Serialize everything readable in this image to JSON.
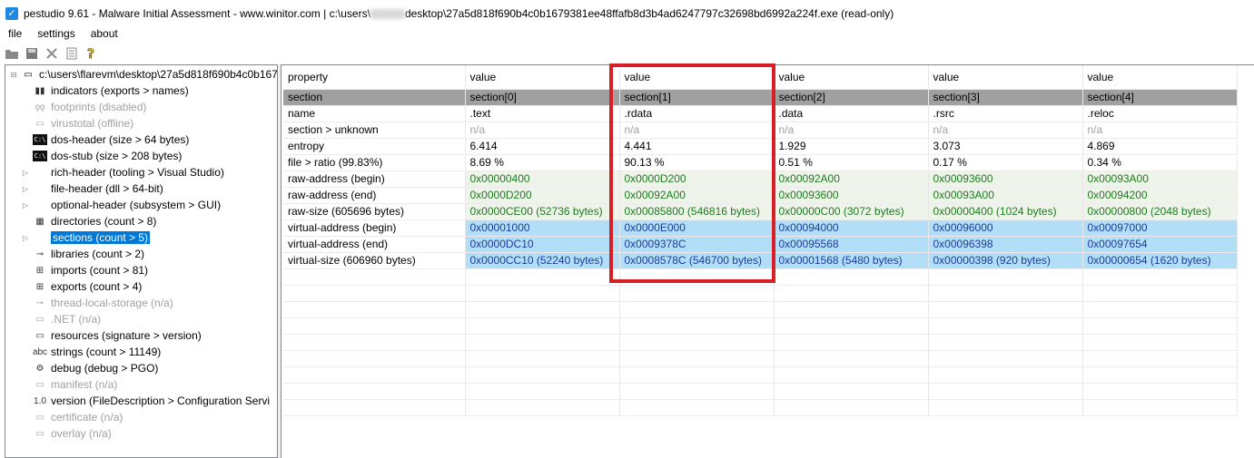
{
  "window": {
    "title_prefix": "pestudio 9.61 - Malware Initial Assessment - www.winitor.com | c:\\users\\",
    "title_suffix": "desktop\\27a5d818f690b4c0b1679381ee48ffafb8d3b4ad6247797c32698bd6992a224f.exe (read-only)",
    "icon": "checkbox-icon"
  },
  "menu": {
    "file": "file",
    "settings": "settings",
    "about": "about"
  },
  "toolbar": {
    "icons": [
      "open-icon",
      "save-icon",
      "close-icon",
      "list-icon",
      "help-icon"
    ]
  },
  "tree": {
    "root": "c:\\users\\flarevm\\desktop\\27a5d818f690b4c0b167",
    "items": [
      {
        "label": "indicators (exports > names)",
        "disabled": false
      },
      {
        "label": "footprints (disabled)",
        "disabled": true
      },
      {
        "label": "virustotal (offline)",
        "disabled": true
      },
      {
        "label": "dos-header (size > 64 bytes)",
        "disabled": false
      },
      {
        "label": "dos-stub (size > 208 bytes)",
        "disabled": false
      },
      {
        "label": "rich-header (tooling > Visual Studio)",
        "disabled": false
      },
      {
        "label": "file-header (dll > 64-bit)",
        "disabled": false
      },
      {
        "label": "optional-header (subsystem > GUI)",
        "disabled": false
      },
      {
        "label": "directories (count > 8)",
        "disabled": false
      },
      {
        "label": "sections (count > 5)",
        "disabled": false
      },
      {
        "label": "libraries (count > 2)",
        "disabled": false
      },
      {
        "label": "imports (count > 81)",
        "disabled": false
      },
      {
        "label": "exports (count > 4)",
        "disabled": false
      },
      {
        "label": "thread-local-storage (n/a)",
        "disabled": true
      },
      {
        "label": ".NET (n/a)",
        "disabled": true
      },
      {
        "label": "resources (signature > version)",
        "disabled": false
      },
      {
        "label": "strings (count > 11149)",
        "disabled": false
      },
      {
        "label": "debug (debug > PGO)",
        "disabled": false
      },
      {
        "label": "manifest (n/a)",
        "disabled": true
      },
      {
        "label": "version (FileDescription > Configuration Servi",
        "disabled": false
      },
      {
        "label": "certificate (n/a)",
        "disabled": true
      },
      {
        "label": "overlay (n/a)",
        "disabled": true
      }
    ],
    "selected": "sections (count > 5)"
  },
  "grid": {
    "headers": [
      "property",
      "value",
      "value",
      "value",
      "value",
      "value"
    ],
    "rows": [
      [
        "section",
        "section[0]",
        "section[1]",
        "section[2]",
        "section[3]",
        "section[4]"
      ],
      [
        "name",
        ".text",
        ".rdata",
        ".data",
        ".rsrc",
        ".reloc"
      ],
      [
        "section > unknown",
        "n/a",
        "n/a",
        "n/a",
        "n/a",
        "n/a"
      ],
      [
        "entropy",
        "6.414",
        "4.441",
        "1.929",
        "3.073",
        "4.869"
      ],
      [
        "file > ratio (99.83%)",
        "8.69 %",
        "90.13 %",
        "0.51 %",
        "0.17 %",
        "0.34 %"
      ],
      [
        "raw-address (begin)",
        "0x00000400",
        "0x0000D200",
        "0x00092A00",
        "0x00093600",
        "0x00093A00"
      ],
      [
        "raw-address (end)",
        "0x0000D200",
        "0x00092A00",
        "0x00093600",
        "0x00093A00",
        "0x00094200"
      ],
      [
        "raw-size (605696 bytes)",
        "0x0000CE00 (52736 bytes)",
        "0x00085800 (546816 bytes)",
        "0x00000C00 (3072 bytes)",
        "0x00000400 (1024 bytes)",
        "0x00000800 (2048 bytes)"
      ],
      [
        "virtual-address (begin)",
        "0x00001000",
        "0x0000E000",
        "0x00094000",
        "0x00096000",
        "0x00097000"
      ],
      [
        "virtual-address (end)",
        "0x0000DC10",
        "0x0009378C",
        "0x00095568",
        "0x00096398",
        "0x00097654"
      ],
      [
        "virtual-size (606960 bytes)",
        "0x0000CC10 (52240 bytes)",
        "0x0008578C (546700 bytes)",
        "0x00001568 (5480 bytes)",
        "0x00000398 (920 bytes)",
        "0x00000654 (1620 bytes)"
      ]
    ]
  },
  "colors": {
    "highlight_box": "#d81f26",
    "selected": "#0078d7",
    "raw_text": "#1e7a1e",
    "virtual_bg": "#b3def7"
  }
}
